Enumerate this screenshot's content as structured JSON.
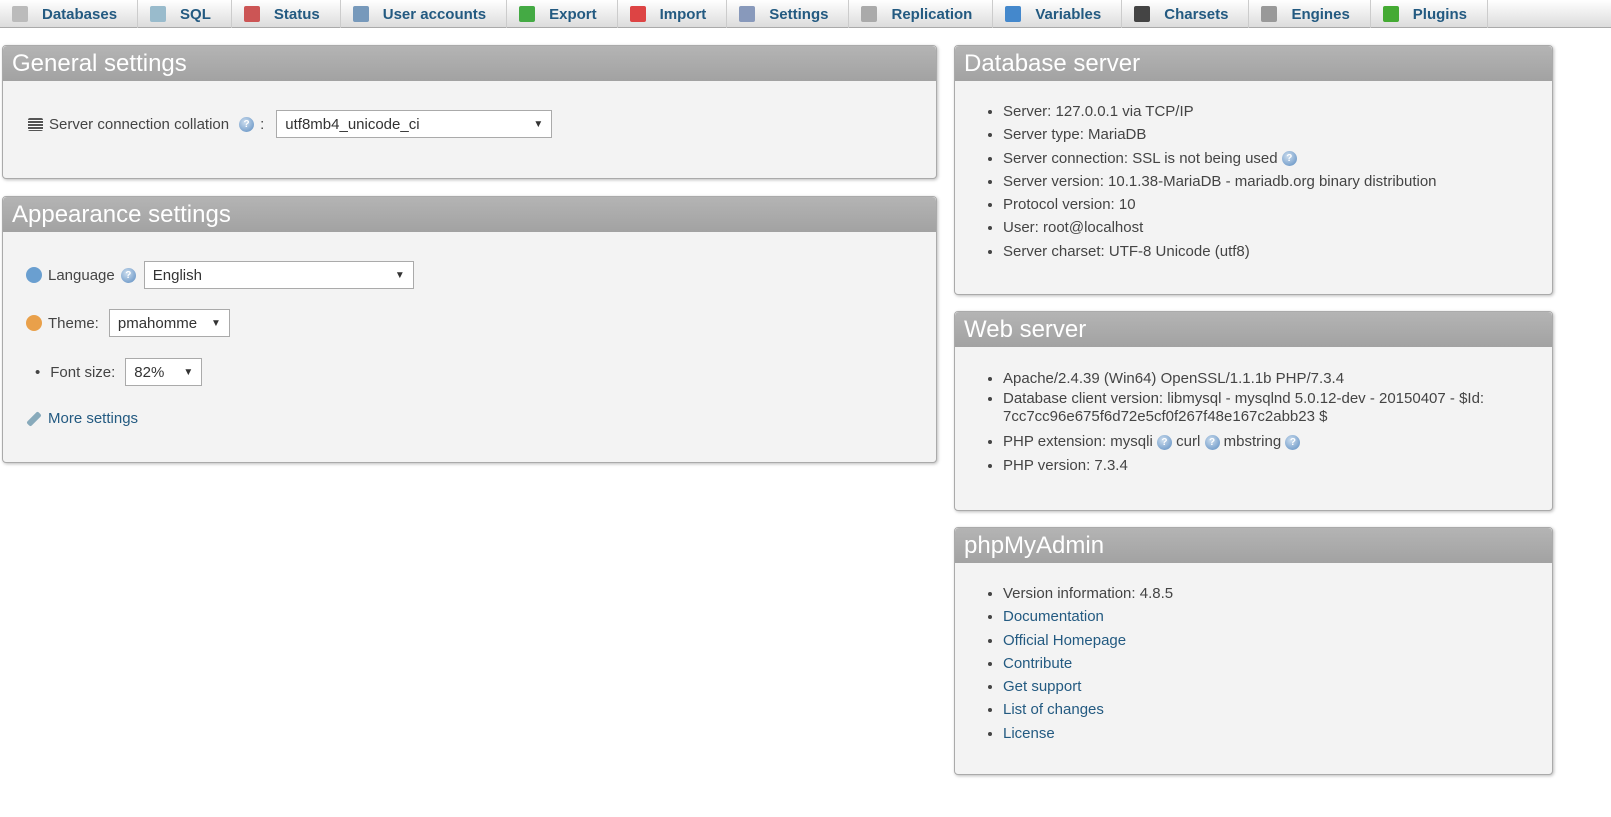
{
  "tabs": [
    {
      "label": "Databases",
      "icon": "database-icon",
      "color": "#bbb"
    },
    {
      "label": "SQL",
      "icon": "sql-icon",
      "color": "#9bc"
    },
    {
      "label": "Status",
      "icon": "status-icon",
      "color": "#c55"
    },
    {
      "label": "User accounts",
      "icon": "user-accounts-icon",
      "color": "#79b"
    },
    {
      "label": "Export",
      "icon": "export-icon",
      "color": "#4a4"
    },
    {
      "label": "Import",
      "icon": "import-icon",
      "color": "#d44"
    },
    {
      "label": "Settings",
      "icon": "settings-icon",
      "color": "#89b"
    },
    {
      "label": "Replication",
      "icon": "replication-icon",
      "color": "#aaa"
    },
    {
      "label": "Variables",
      "icon": "variables-icon",
      "color": "#48c"
    },
    {
      "label": "Charsets",
      "icon": "charsets-icon",
      "color": "#444"
    },
    {
      "label": "Engines",
      "icon": "engines-icon",
      "color": "#999"
    },
    {
      "label": "Plugins",
      "icon": "plugins-icon",
      "color": "#4a3"
    }
  ],
  "general": {
    "title": "General settings",
    "collation_label": "Server connection collation",
    "colon": ":",
    "collation_value": "utf8mb4_unicode_ci"
  },
  "appearance": {
    "title": "Appearance settings",
    "language_label": "Language",
    "language_value": "English",
    "theme_label": "Theme:",
    "theme_value": "pmahomme",
    "fontsize_label": "Font size:",
    "fontsize_value": "82%",
    "more_settings": "More settings"
  },
  "db_server": {
    "title": "Database server",
    "items": [
      "Server: 127.0.0.1 via TCP/IP",
      "Server type: MariaDB",
      "Server connection: SSL is not being used",
      "Server version: 10.1.38-MariaDB - mariadb.org binary distribution",
      "Protocol version: 10",
      "User: root@localhost",
      "Server charset: UTF-8 Unicode (utf8)"
    ]
  },
  "web_server": {
    "title": "Web server",
    "apache": "Apache/2.4.39 (Win64) OpenSSL/1.1.1b PHP/7.3.4",
    "client": "Database client version: libmysql - mysqlnd 5.0.12-dev - 20150407 - $Id: 7cc7cc96e675f6d72e5cf0f267f48e167c2abb23 $",
    "ext_label": "PHP extension:",
    "ext": [
      "mysqli",
      "curl",
      "mbstring"
    ],
    "php_version": "PHP version: 7.3.4"
  },
  "pma": {
    "title": "phpMyAdmin",
    "version": "Version information: 4.8.5",
    "links": [
      "Documentation",
      "Official Homepage",
      "Contribute",
      "Get support",
      "List of changes",
      "License"
    ]
  }
}
